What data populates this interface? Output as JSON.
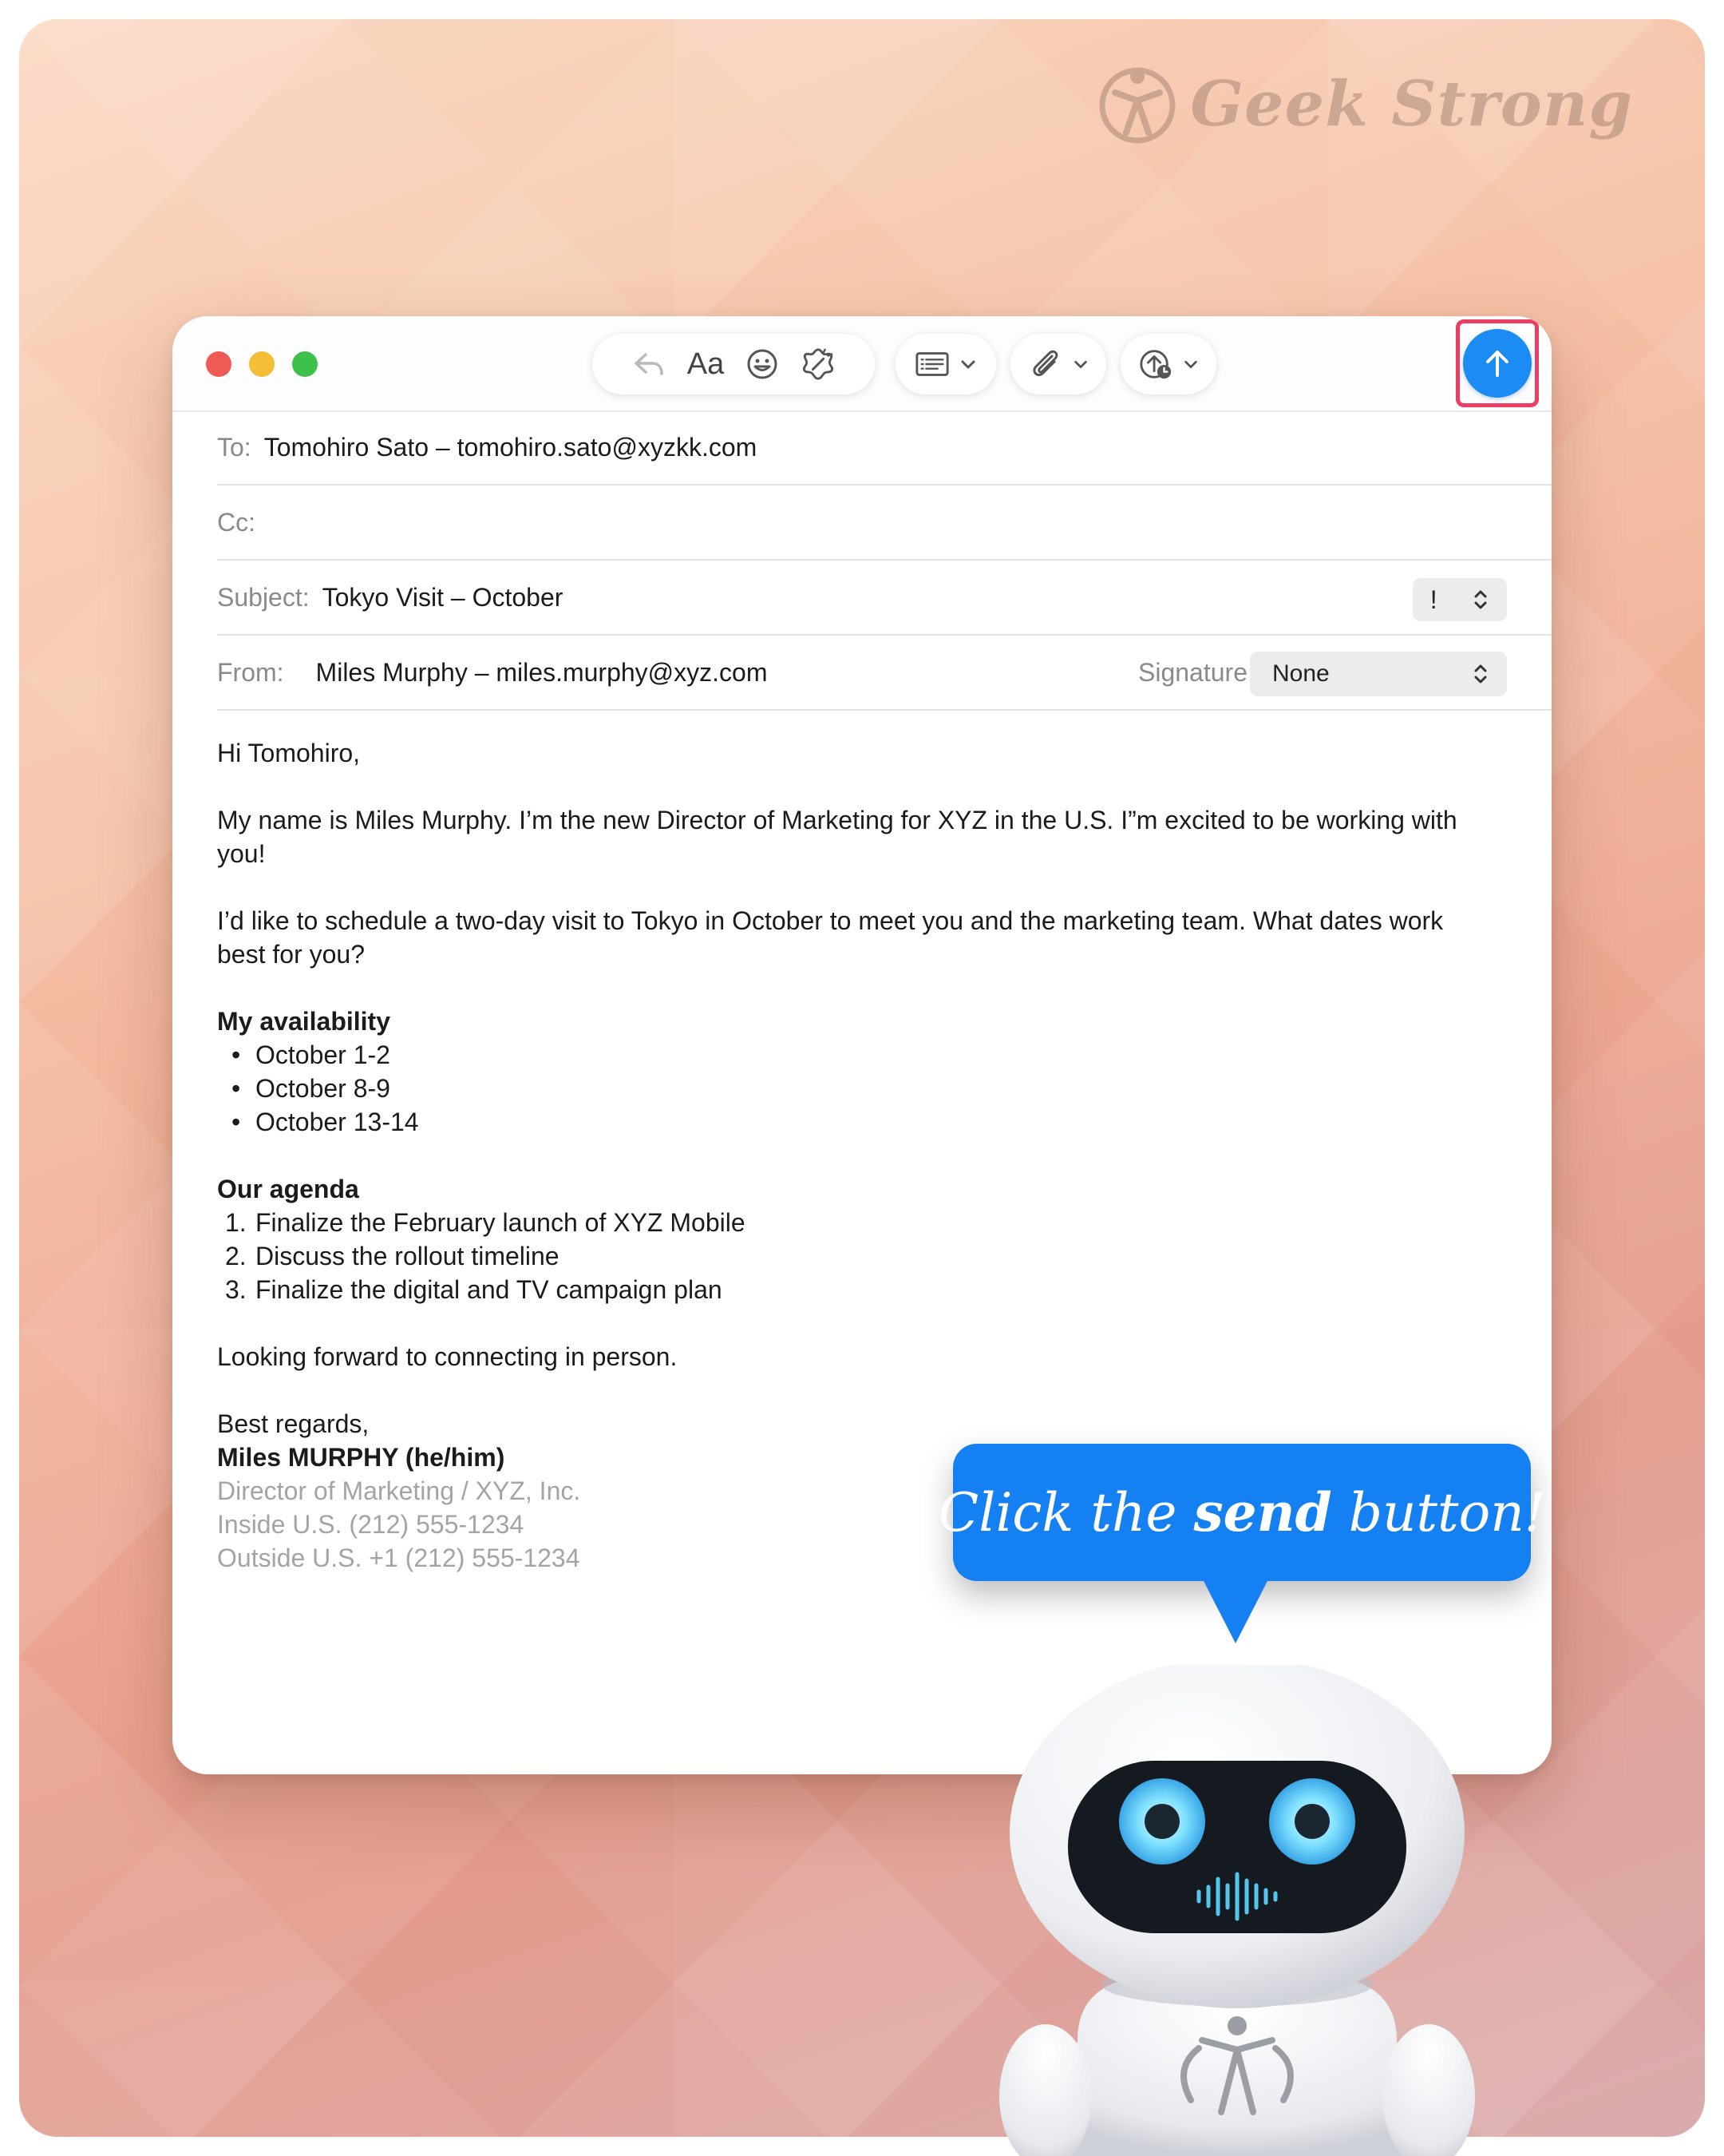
{
  "brand": {
    "name": "Geek Strong"
  },
  "window": {
    "toolbar": {
      "reply_icon": "reply-icon",
      "format_label": "Aa",
      "emoji_icon": "emoji-icon",
      "writing_tools_icon": "writing-tools-icon",
      "header_fields_icon": "header-fields-icon",
      "attach_icon": "paperclip-icon",
      "send_later_icon": "send-later-icon",
      "send_icon": "arrow-up-icon"
    },
    "colors": {
      "send": "#1a8cf4",
      "highlight": "#ec3e62",
      "callout": "#1580f2"
    }
  },
  "compose": {
    "to_label": "To:",
    "to_value": "Tomohiro Sato – tomohiro.sato@xyzkk.com",
    "cc_label": "Cc:",
    "cc_value": "",
    "subject_label": "Subject:",
    "subject_value": "Tokyo Visit – October",
    "priority_value": "!",
    "from_label": "From:",
    "from_value": "Miles Murphy – miles.murphy@xyz.com",
    "signature_label": "Signature:",
    "signature_value": "None"
  },
  "body": {
    "greeting": "Hi Tomohiro,",
    "para1": "My name is Miles Murphy. I’m the new Director of Marketing for XYZ in the U.S. I”m excited to be working with you!",
    "para2": "I’d like to schedule a two-day visit to Tokyo in October to meet you and the marketing team. What dates work best for you?",
    "availability_heading": "My availability",
    "availability": [
      "October 1-2",
      "October 8-9",
      "October 13-14"
    ],
    "agenda_heading": "Our agenda",
    "agenda": [
      "Finalize the February launch of XYZ Mobile",
      "Discuss the rollout timeline",
      "Finalize the digital and TV campaign plan"
    ],
    "closing": "Looking forward to connecting in person.",
    "signoff": "Best regards,",
    "sig_name": "Miles MURPHY (he/him)",
    "sig_title": "Director of Marketing / XYZ, Inc.",
    "sig_phone1": "Inside U.S. (212) 555-1234",
    "sig_phone2": "Outside U.S. +1 (212) 555-1234"
  },
  "callout": {
    "prefix": "Click the ",
    "emphasis": "send",
    "suffix": " button!"
  }
}
